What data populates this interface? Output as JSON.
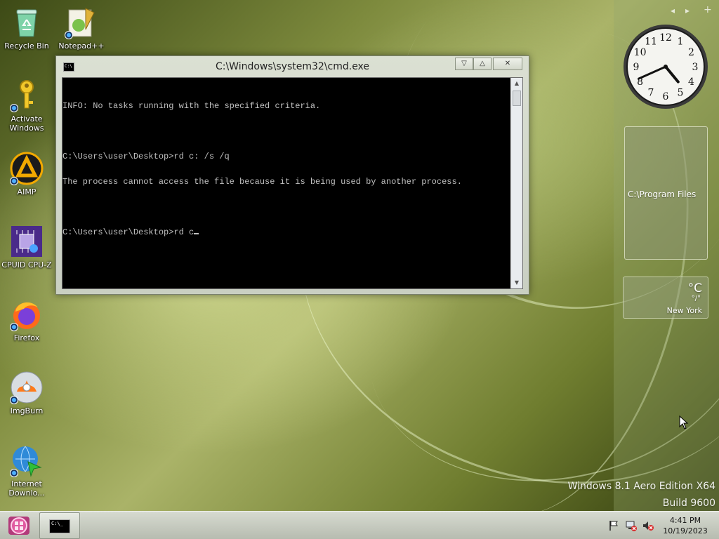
{
  "desktop": {
    "icons": [
      {
        "label": "Recycle Bin",
        "icon": "recycle-bin-icon"
      },
      {
        "label": "Notepad++",
        "icon": "notepad-plus-plus-icon"
      },
      {
        "label": "Activate Windows",
        "icon": "key-icon"
      },
      {
        "label": "AIMP",
        "icon": "aimp-icon"
      },
      {
        "label": "CPUID CPU-Z",
        "icon": "cpu-z-icon"
      },
      {
        "label": "Firefox",
        "icon": "firefox-icon"
      },
      {
        "label": "ImgBurn",
        "icon": "imgburn-icon"
      },
      {
        "label": "Internet Downlo...",
        "icon": "internet-download-manager-icon"
      }
    ]
  },
  "cmd_window": {
    "title": "C:\\Windows\\system32\\cmd.exe",
    "lines": [
      "INFO: No tasks running with the specified criteria.",
      "",
      "C:\\Users\\user\\Desktop>rd c: /s /q",
      "The process cannot access the file because it is being used by another process.",
      "",
      "C:\\Users\\user\\Desktop>rd c"
    ],
    "icon_text": "C:\\"
  },
  "gadgets": {
    "clock": {
      "hour": 4,
      "minute": 41
    },
    "slideshow_label": "C:\\Program Files",
    "weather": {
      "temp": "°C",
      "range": "°/°",
      "city": "New York"
    }
  },
  "watermark": {
    "line1": "Windows 8.1 Aero Edition X64",
    "line2": "Build 9600"
  },
  "taskbar": {
    "time": "4:41 PM",
    "date": "10/19/2023",
    "task_icon_text": "C:\\_"
  }
}
